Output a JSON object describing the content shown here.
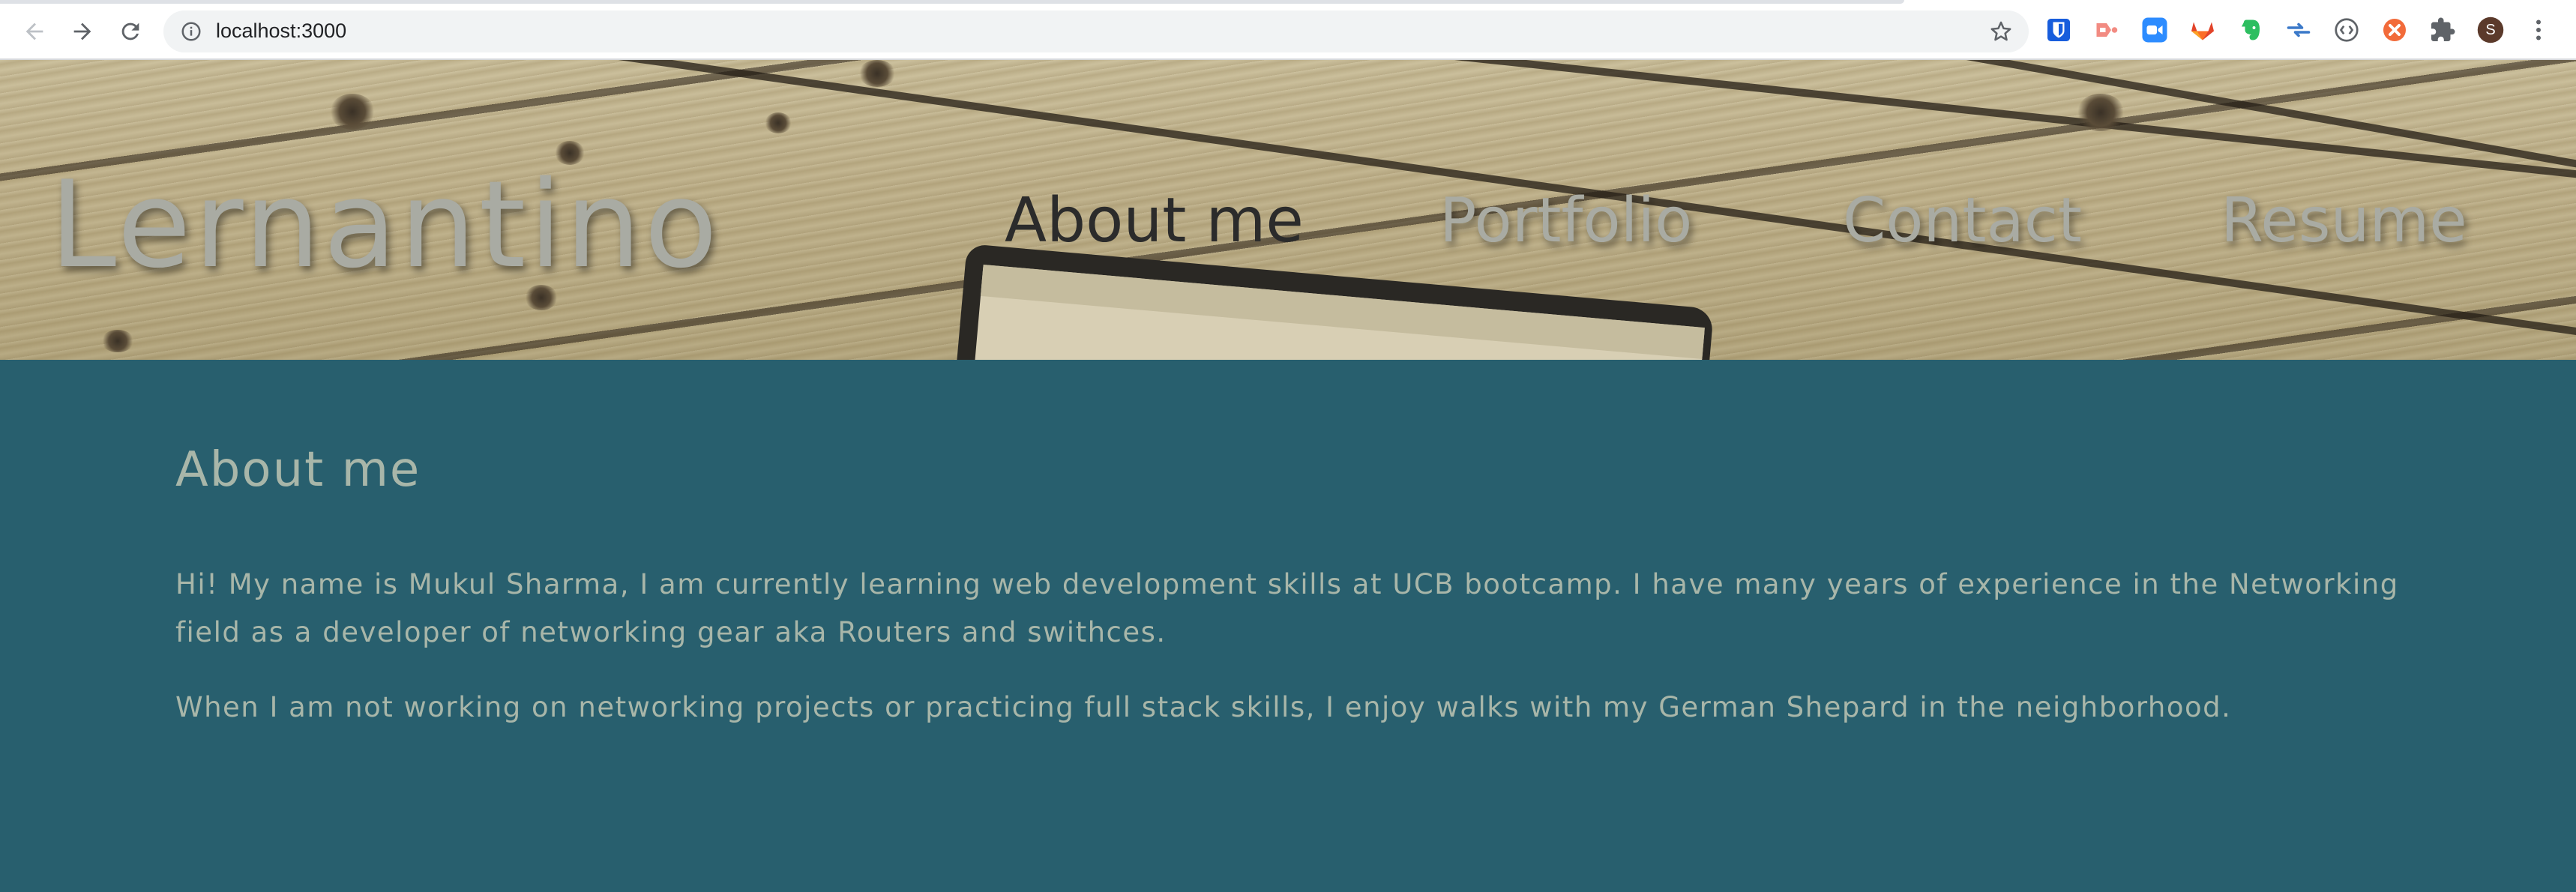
{
  "browser": {
    "url": "localhost:3000",
    "profile_initial": "S",
    "icons": [
      "back-arrow-icon",
      "forward-arrow-icon",
      "reload-icon",
      "info-icon",
      "bookmark-star-icon",
      "bitwarden-icon",
      "pointer-extension-icon",
      "zoom-icon",
      "gitlab-icon",
      "evernote-icon",
      "transfer-arrows-icon",
      "code-brackets-icon",
      "orange-extension-icon",
      "puzzle-extensions-icon",
      "kebab-menu-icon"
    ]
  },
  "header": {
    "brand": "Lernantino",
    "nav": [
      {
        "label": "About me",
        "active": true
      },
      {
        "label": "Portfolio",
        "active": false
      },
      {
        "label": "Contact",
        "active": false
      },
      {
        "label": "Resume",
        "active": false
      }
    ]
  },
  "about": {
    "title": "About me",
    "paragraphs": [
      "Hi! My name is Mukul Sharma, I am currently learning web development skills at UCB bootcamp. I have many years of experience in the Networking field as a developer of networking gear aka Routers and swithces.",
      "When I am not working on networking projects or practicing full stack skills, I enjoy walks with my German Shepard in the neighborhood."
    ]
  },
  "colors": {
    "content_bg": "#285f6e",
    "text": "#a8b6a9",
    "nav_inactive": "#a9aba3",
    "nav_active": "#2b2b2b"
  }
}
